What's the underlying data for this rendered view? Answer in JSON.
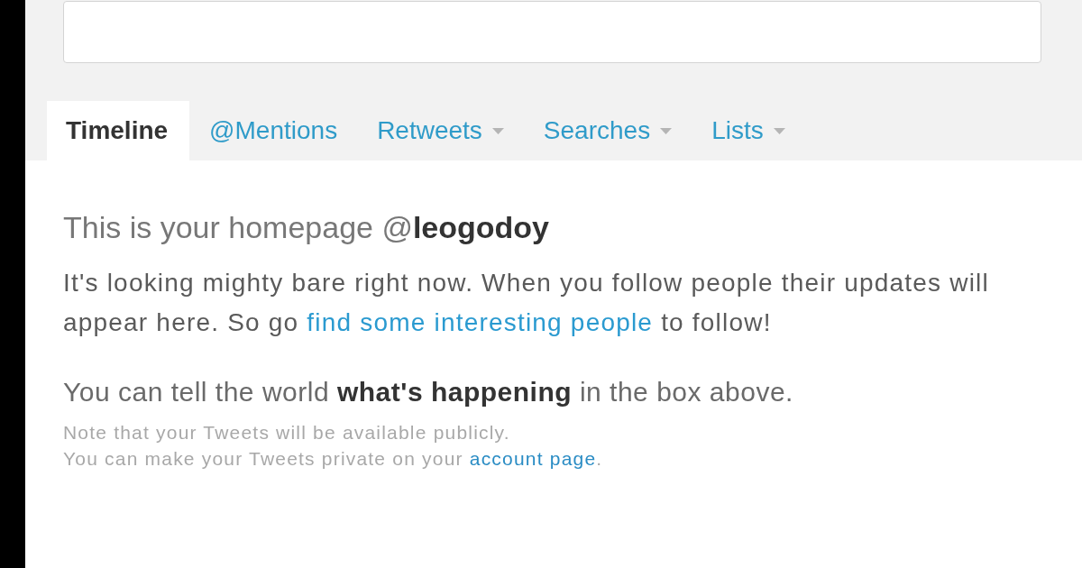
{
  "tabs": [
    {
      "label": "Timeline",
      "selected": true,
      "dropdown": false
    },
    {
      "label": "@Mentions",
      "selected": false,
      "dropdown": false
    },
    {
      "label": "Retweets",
      "selected": false,
      "dropdown": true
    },
    {
      "label": "Searches",
      "selected": false,
      "dropdown": true
    },
    {
      "label": "Lists",
      "selected": false,
      "dropdown": true
    }
  ],
  "content": {
    "heading": "This is your homepage @**leogodoy**",
    "message": [
      {
        "kind": "text",
        "text": "It's looking mighty bare right now. When you follow people their updates will appear here. So go "
      },
      {
        "kind": "link",
        "text": "find some interesting people"
      },
      {
        "kind": "text",
        "text": " to follow!"
      }
    ],
    "prompt": "You can tell the world **what's happening** in the box above.",
    "note": [
      [
        {
          "kind": "text",
          "text": "Note that your Tweets will be available publicly."
        }
      ],
      [
        {
          "kind": "text",
          "text": "You can make your Tweets private on your "
        },
        {
          "kind": "link",
          "text": "account page"
        },
        {
          "kind": "text",
          "text": "."
        }
      ]
    ]
  }
}
